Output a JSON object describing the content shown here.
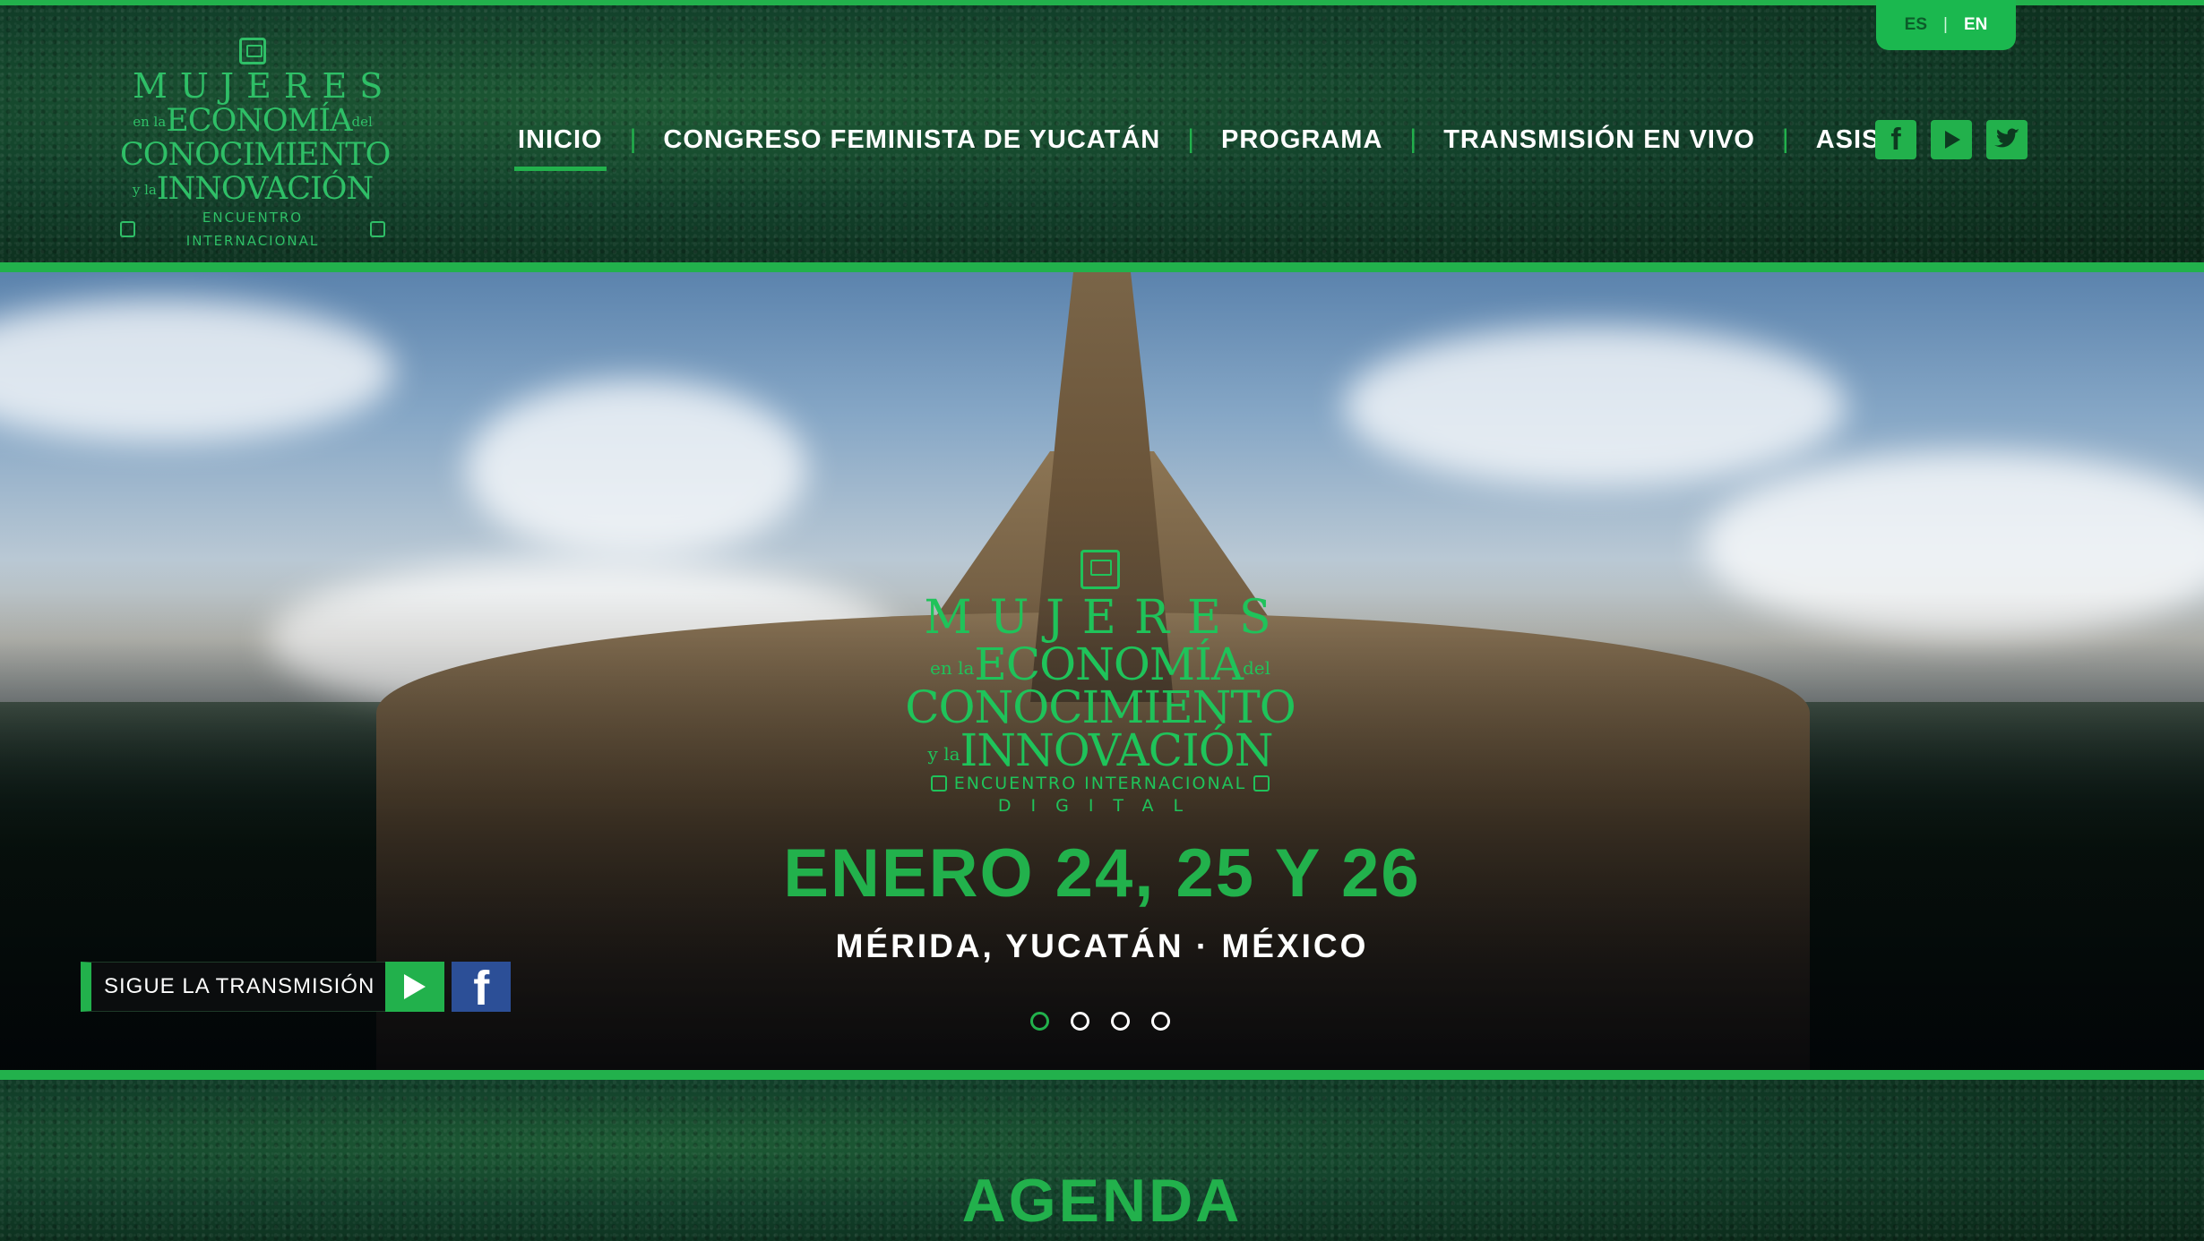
{
  "lang": {
    "es": "ES",
    "en": "EN",
    "separator": "|"
  },
  "logo": {
    "line1": "MUJERES",
    "line2_small": "en la",
    "line2": "ECONOMÍA",
    "line2_suffix": "del",
    "line3": "CONOCIMIENTO",
    "line4_small": "y la",
    "line4": "INNOVACIÓN",
    "line5": "ENCUENTRO INTERNACIONAL",
    "line6": "DIGITAL"
  },
  "nav": {
    "items": [
      {
        "label": "INICIO"
      },
      {
        "label": "CONGRESO FEMINISTA DE YUCATÁN"
      },
      {
        "label": "PROGRAMA"
      },
      {
        "label": "TRANSMISIÓN EN VIVO"
      },
      {
        "label": "ASISTE"
      }
    ],
    "separator": "|"
  },
  "social": {
    "icons": [
      "facebook-icon",
      "youtube-icon",
      "twitter-icon"
    ],
    "facebook_glyph": "f"
  },
  "hero": {
    "date": "ENERO 24, 25 Y 26",
    "place": "MÉRIDA, YUCATÁN · MÉXICO",
    "follow_label": "SIGUE LA TRANSMISIÓN",
    "fb_glyph": "f",
    "slides": 4,
    "active_slide": 1
  },
  "agenda": {
    "title": "AGENDA"
  },
  "colors": {
    "accent": "#22b14c",
    "dark_green": "#0f3a22",
    "facebook": "#2c4f97"
  }
}
